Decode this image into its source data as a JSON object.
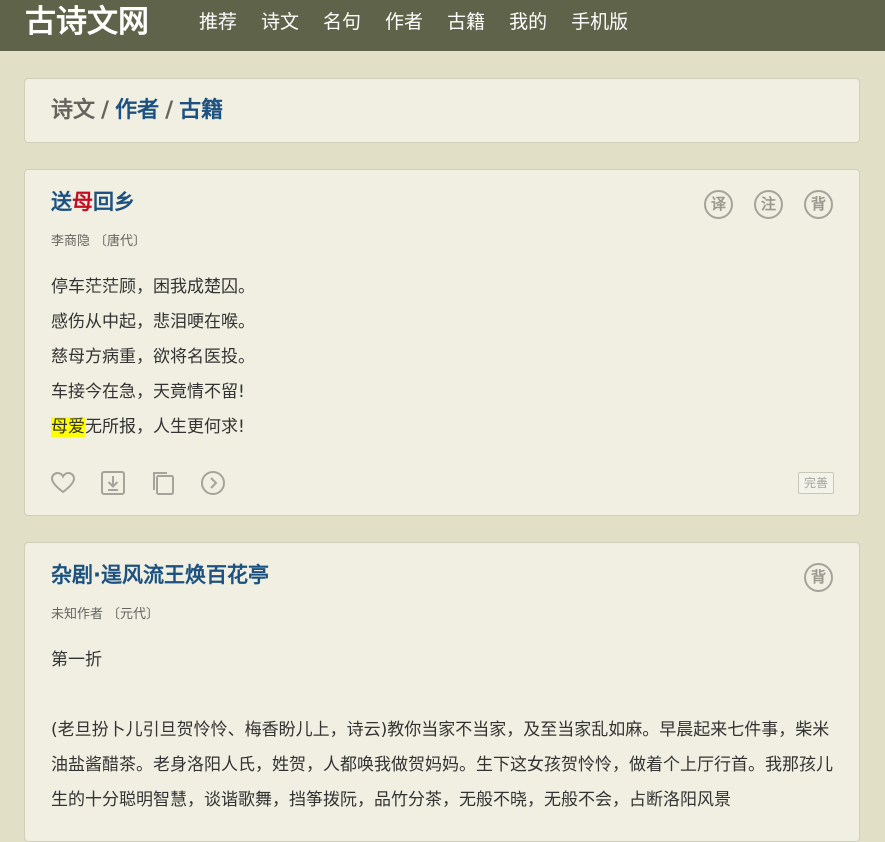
{
  "header": {
    "logo": "古诗文网",
    "nav": [
      "推荐",
      "诗文",
      "名句",
      "作者",
      "古籍",
      "我的",
      "手机版"
    ]
  },
  "breadcrumb": {
    "current": "诗文",
    "sep1": "/",
    "link1": "作者",
    "sep2": "/",
    "link2": "古籍"
  },
  "poems": [
    {
      "title_pre": "送",
      "title_hl": "母",
      "title_post": "回乡",
      "author": "李商隐",
      "dynasty": "〔唐代〕",
      "icons": [
        "译",
        "注",
        "背"
      ],
      "lines": [
        "停车茫茫顾，困我成楚囚。",
        "感伤从中起，悲泪哽在喉。",
        "慈母方病重，欲将名医投。",
        "车接今在急，天竟情不留!"
      ],
      "last_line_mark": "母爱",
      "last_line_rest": "无所报，人生更何求!",
      "fix_label": "完善"
    },
    {
      "title": "杂剧·逞风流王焕百花亭",
      "author": "未知作者",
      "dynasty": "〔元代〕",
      "icons": [
        "背"
      ],
      "first": "第一折",
      "para1": "(老旦扮卜儿引旦贺怜怜、梅香盼儿上，诗云)教你当家不当家，及至当家乱如麻。早晨起来七件事，柴米油盐酱醋茶。老身洛阳人氏，姓贺，人都唤我做贺妈妈。生下这女孩贺怜怜，做着个上厅行首。我那孩儿生的十分聪明智慧，谈谐歌舞，挡筝拨阮，品竹分茶，无般不晓，无般不会，占断洛阳风景"
    }
  ],
  "colors": {
    "topbar": "#5f6349",
    "background": "#e1e0c7",
    "card": "#f0efe2",
    "link": "#1c5180",
    "highlight_red": "#c30d23",
    "highlight_bg": "#ffff00"
  }
}
